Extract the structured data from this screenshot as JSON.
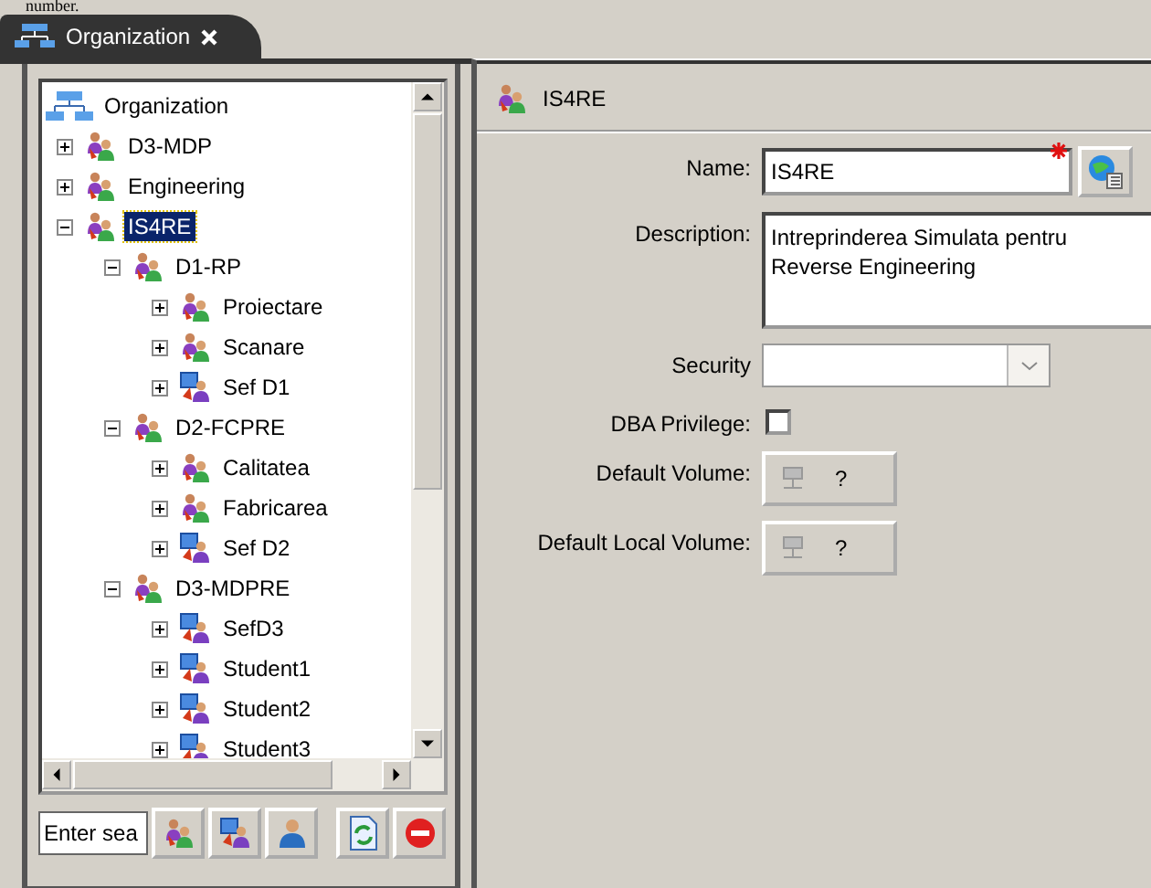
{
  "caption": "number.",
  "tab": {
    "title": "Organization",
    "selected": true
  },
  "tree": {
    "items": [
      {
        "label": "Organization",
        "kind": "root",
        "selected": false,
        "children": [
          {
            "label": "D3-MDP",
            "kind": "group",
            "expanded": false,
            "selected": false
          },
          {
            "label": "Engineering",
            "kind": "group",
            "expanded": false,
            "selected": false
          },
          {
            "label": "IS4RE",
            "kind": "group",
            "expanded": true,
            "selected": true,
            "children": [
              {
                "label": "D1-RP",
                "kind": "group",
                "expanded": true,
                "selected": false,
                "children": [
                  {
                    "label": "Proiectare",
                    "kind": "group",
                    "expanded": false,
                    "selected": false
                  },
                  {
                    "label": "Scanare",
                    "kind": "group",
                    "expanded": false,
                    "selected": false
                  },
                  {
                    "label": "Sef D1",
                    "kind": "user",
                    "expanded": false,
                    "selected": false
                  }
                ]
              },
              {
                "label": "D2-FCPRE",
                "kind": "group",
                "expanded": true,
                "selected": false,
                "children": [
                  {
                    "label": "Calitatea",
                    "kind": "group",
                    "expanded": false,
                    "selected": false
                  },
                  {
                    "label": "Fabricarea",
                    "kind": "group",
                    "expanded": false,
                    "selected": false
                  },
                  {
                    "label": "Sef D2",
                    "kind": "user",
                    "expanded": false,
                    "selected": false
                  }
                ]
              },
              {
                "label": "D3-MDPRE",
                "kind": "group",
                "expanded": true,
                "selected": false,
                "children": [
                  {
                    "label": "SefD3",
                    "kind": "user",
                    "expanded": false,
                    "selected": false
                  },
                  {
                    "label": "Student1",
                    "kind": "user",
                    "expanded": false,
                    "selected": false
                  },
                  {
                    "label": "Student2",
                    "kind": "user",
                    "expanded": false,
                    "selected": false
                  },
                  {
                    "label": "Student3",
                    "kind": "user",
                    "expanded": false,
                    "selected": false
                  }
                ]
              }
            ]
          }
        ]
      }
    ]
  },
  "search": {
    "placeholder": "Enter sea"
  },
  "toolbar": [
    {
      "kind": "group"
    },
    {
      "kind": "user"
    },
    {
      "kind": "person"
    },
    {
      "kind": "refresh"
    },
    {
      "kind": "stop"
    }
  ],
  "detail": {
    "title": "IS4RE",
    "fields": [
      {
        "kind": "text",
        "label": "Name:",
        "value": "IS4RE",
        "required": true
      },
      {
        "kind": "textarea",
        "label": "Description:",
        "value": "Intreprinderea Simulata pentru Reverse Engineering"
      },
      {
        "kind": "select",
        "label": "Security"
      },
      {
        "kind": "checkbox",
        "label": "DBA Privilege:",
        "checked": false
      },
      {
        "kind": "volume",
        "label": "Default Volume:",
        "value": "?"
      },
      {
        "kind": "volume",
        "label": "Default Local Volume:",
        "value": "?"
      }
    ]
  }
}
